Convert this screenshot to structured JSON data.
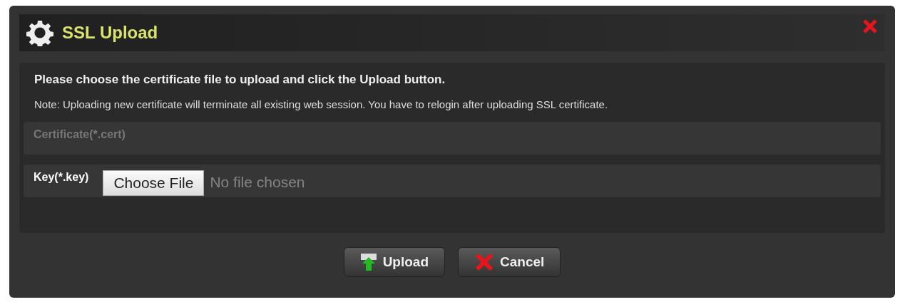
{
  "window": {
    "title": "SSL Upload"
  },
  "instruction": "Please choose the certificate file to upload and click the Upload button.",
  "note": "Note: Uploading new certificate will terminate all existing web session. You have to relogin after uploading SSL certificate.",
  "fields": [
    {
      "kind": "label",
      "label": "Certificate(*.cert)",
      "disabled": true
    },
    {
      "kind": "file",
      "label": "Key(*.key)",
      "disabled": false,
      "button": "Choose File",
      "status": "No file chosen"
    }
  ],
  "buttons": [
    {
      "kind": "upload",
      "label": "Upload"
    },
    {
      "kind": "cancel",
      "label": "Cancel"
    }
  ]
}
